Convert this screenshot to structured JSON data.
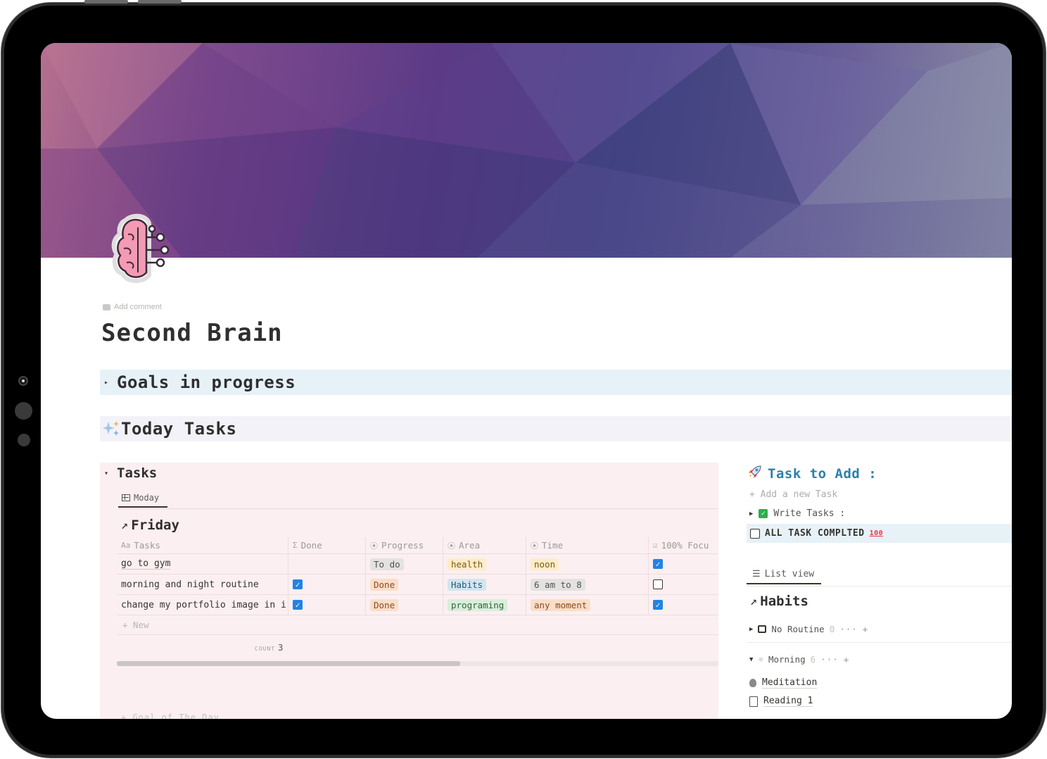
{
  "page": {
    "add_comment": "Add comment",
    "title": "Second Brain",
    "icon": "brain-circuit-icon"
  },
  "goals": {
    "label": "Goals in progress"
  },
  "today": {
    "label": "Today Tasks",
    "icon": "sparkles-icon"
  },
  "tasks_db": {
    "title": "Tasks",
    "view_tab": "Moday",
    "group": "Friday",
    "columns": [
      {
        "icon": "Aa",
        "label": "Tasks"
      },
      {
        "icon": "Σ",
        "label": "Done"
      },
      {
        "icon": "⦿",
        "label": "Progress"
      },
      {
        "icon": "⦿",
        "label": "Area"
      },
      {
        "icon": "⦿",
        "label": "Time"
      },
      {
        "icon": "☑",
        "label": "100% Focu"
      }
    ],
    "rows": [
      {
        "task": "go to gym",
        "done": false,
        "progress": "To do",
        "area": "health",
        "time": "noon",
        "focus": true
      },
      {
        "task": "morning and night routine",
        "done": true,
        "progress": "Done",
        "area": "Habits",
        "time": "6 am to 8",
        "focus": false
      },
      {
        "task": "change my portfolio image in i",
        "done": true,
        "progress": "Done",
        "area": "programing",
        "time": "any moment",
        "focus": true
      }
    ],
    "new_label": "+ New",
    "count_label": "COUNT",
    "count_value": "3",
    "cut_text": "+ Goal of The Day"
  },
  "task_to_add": {
    "title": "Task to Add :",
    "add_placeholder": "+ Add a new Task",
    "write_tasks": "Write Tasks :",
    "all_done": "ALL TASK COMPLTED",
    "all_done_badge": "100"
  },
  "habits": {
    "view_tab": "List view",
    "title": "Habits",
    "groups": [
      {
        "label": "No Routine",
        "count": "0"
      },
      {
        "label": "Morning",
        "count": "6"
      }
    ],
    "items": [
      {
        "label": "Meditation"
      },
      {
        "label": "Reading 1"
      }
    ]
  },
  "colors": {
    "accent_blue": "#2e7faa",
    "checkbox_blue": "#2383e2",
    "panel_pink": "#fbeff1",
    "callout_blue": "#e7f1f8"
  }
}
